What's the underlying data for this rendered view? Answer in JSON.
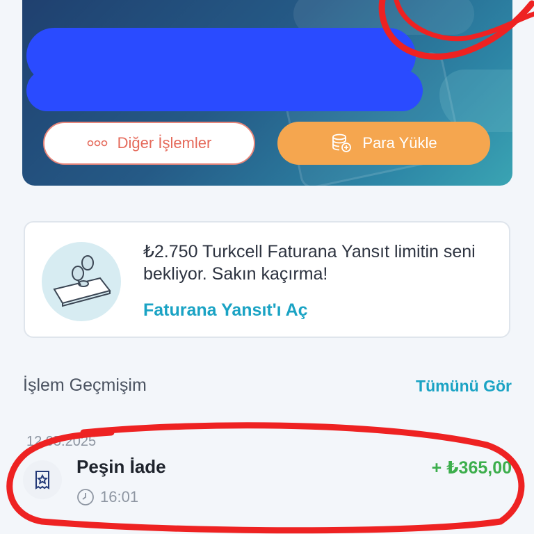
{
  "hero": {
    "other_actions_label": "Diğer İşlemler",
    "load_money_label": "Para Yükle"
  },
  "promo": {
    "message": "₺2.750 Turkcell Faturana Yansıt limitin seni bekliyor. Sakın kaçırma!",
    "link": "Faturana Yansıt'ı Aç"
  },
  "history": {
    "title": "İşlem Geçmişim",
    "see_all": "Tümünü Gör",
    "transactions": [
      {
        "date": "12.05.2025",
        "title": "Peşin İade",
        "time": "16:01",
        "amount": "+ ₺365,00"
      }
    ]
  },
  "colors": {
    "accent": "#1aa3c4",
    "orange": "#f5a64f",
    "coral": "#e56a5b",
    "positive": "#3cae4c",
    "annotation_red": "#ee2222",
    "scribble_blue": "#2a4bff"
  }
}
